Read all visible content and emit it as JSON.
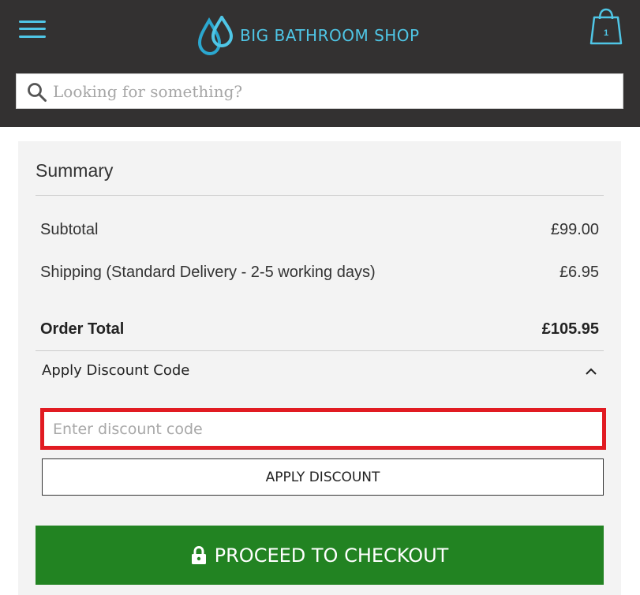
{
  "header": {
    "brand": "BIG BATHROOM SHOP",
    "cart_count": "1",
    "icons": {
      "menu": "hamburger-menu-icon",
      "logo": "water-drops-logo",
      "cart": "shopping-bag-icon"
    },
    "accent_color": "#4fc6e6",
    "background_color": "#333131"
  },
  "search": {
    "placeholder": "Looking for something?",
    "value": ""
  },
  "summary": {
    "title": "Summary",
    "rows": [
      {
        "label": "Subtotal",
        "value": "£99.00"
      },
      {
        "label": "Shipping (Standard Delivery - 2-5 working days)",
        "value": "£6.95"
      }
    ],
    "total": {
      "label": "Order Total",
      "value": "£105.95"
    },
    "discount": {
      "toggle_label": "Apply Discount Code",
      "expanded": true,
      "input_placeholder": "Enter discount code",
      "input_value": "",
      "apply_label": "APPLY DISCOUNT",
      "highlight_color": "#e11b22"
    },
    "checkout": {
      "label": "PROCEED TO CHECKOUT",
      "color": "#228322"
    }
  }
}
